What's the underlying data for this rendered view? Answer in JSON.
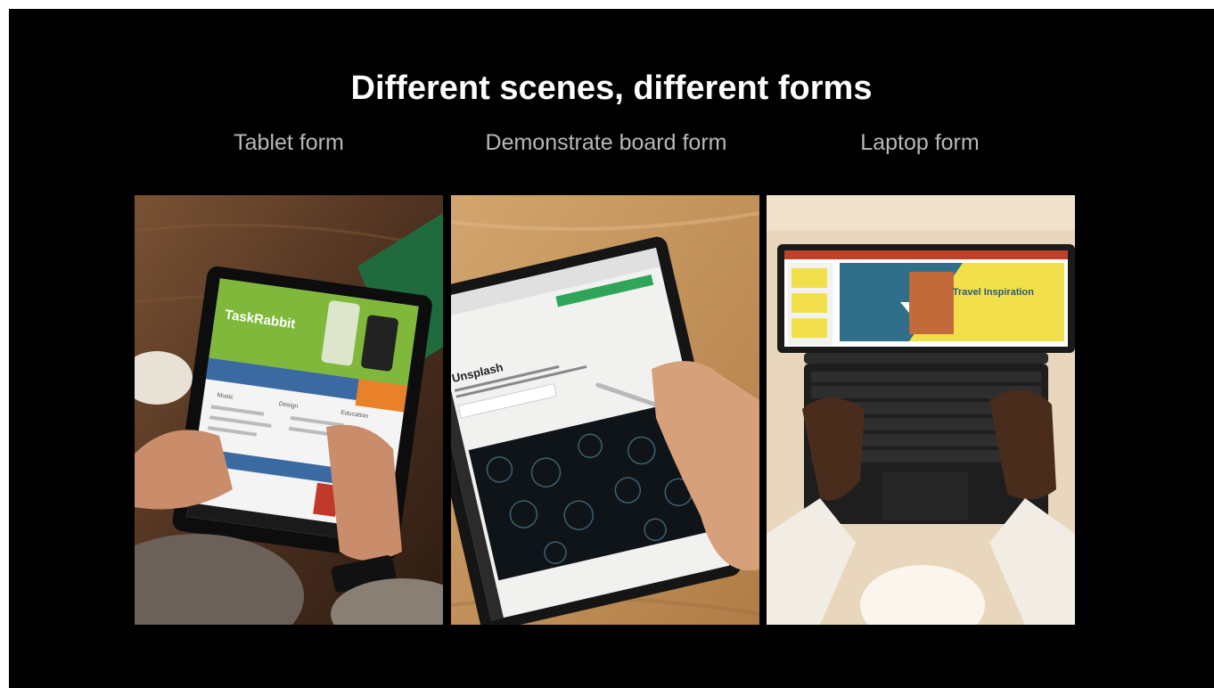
{
  "slide": {
    "title": "Different scenes, different forms",
    "forms": [
      {
        "label": "Tablet form"
      },
      {
        "label": "Demonstrate board form"
      },
      {
        "label": "Laptop form"
      }
    ]
  },
  "tablet_screen": {
    "brand": "TaskRabbit",
    "section_labels": [
      "Music",
      "Design",
      "Education"
    ]
  },
  "board_screen": {
    "site_name": "Unsplash"
  },
  "laptop_screen": {
    "slide_title": "Travel Inspiration"
  },
  "colors": {
    "background": "#000000",
    "title": "#ffffff",
    "label": "#b8b8b8",
    "wood_dark": "#5a3a22",
    "wood_light": "#c89a63",
    "desk_beige": "#e8d6bd",
    "yellow": "#f2e04a"
  }
}
